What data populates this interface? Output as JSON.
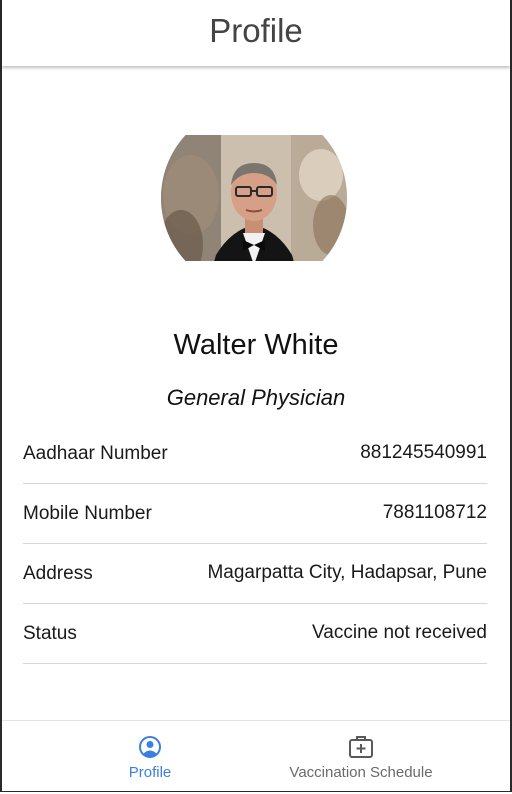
{
  "header": {
    "title": "Profile"
  },
  "profile": {
    "name": "Walter White",
    "role": "General Physician"
  },
  "details": [
    {
      "label": "Aadhaar Number",
      "value": "881245540991"
    },
    {
      "label": "Mobile Number",
      "value": "7881108712"
    },
    {
      "label": "Address",
      "value": "Magarpatta City, Hadapsar, Pune"
    },
    {
      "label": "Status",
      "value": "Vaccine not received"
    }
  ],
  "bottom_nav": {
    "items": [
      {
        "label": "Profile",
        "icon": "account-circle-icon",
        "active": true
      },
      {
        "label": "Vaccination Schedule",
        "icon": "medical-bag-icon",
        "active": false
      }
    ]
  },
  "colors": {
    "accent": "#3b7fe0",
    "inactive": "#6a6a6a",
    "divider": "#d6d6d6",
    "title": "#444444"
  }
}
